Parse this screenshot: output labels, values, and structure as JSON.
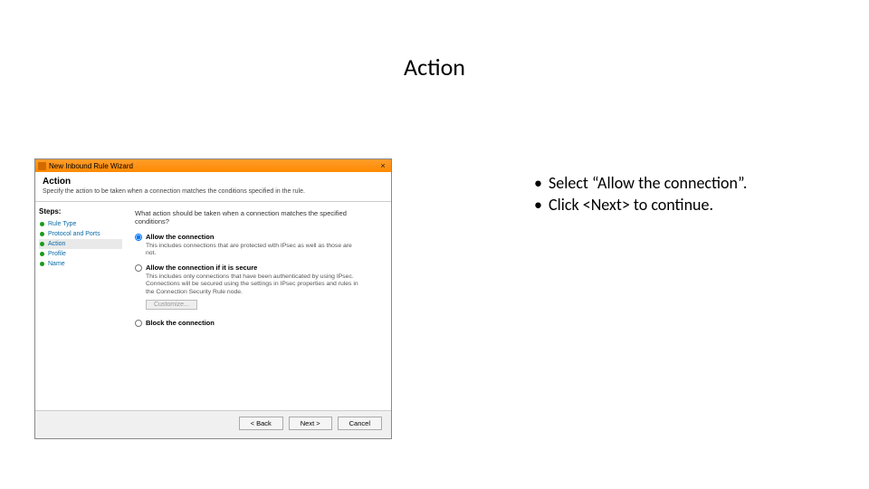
{
  "slide": {
    "title": "Action",
    "bullets": [
      "Select “Allow the connection”.",
      "Click <Next> to continue."
    ]
  },
  "wizard": {
    "titlebar": "New Inbound Rule Wizard",
    "header": {
      "title": "Action",
      "subtitle": "Specify the action to be taken when a connection matches the conditions specified in the rule."
    },
    "steps_label": "Steps:",
    "steps": [
      {
        "label": "Rule Type"
      },
      {
        "label": "Protocol and Ports"
      },
      {
        "label": "Action",
        "active": true
      },
      {
        "label": "Profile"
      },
      {
        "label": "Name"
      }
    ],
    "content": {
      "question": "What action should be taken when a connection matches the specified conditions?",
      "options": [
        {
          "label": "Allow the connection",
          "desc": "This includes connections that are protected with IPsec as well as those are not.",
          "checked": true
        },
        {
          "label": "Allow the connection if it is secure",
          "desc": "This includes only connections that have been authenticated by using IPsec. Connections will be secured using the settings in IPsec properties and rules in the Connection Security Rule node.",
          "checked": false,
          "customize": true
        },
        {
          "label": "Block the connection",
          "desc": "",
          "checked": false
        }
      ],
      "customize_label": "Customize..."
    },
    "buttons": {
      "back": "< Back",
      "next": "Next >",
      "cancel": "Cancel"
    }
  }
}
